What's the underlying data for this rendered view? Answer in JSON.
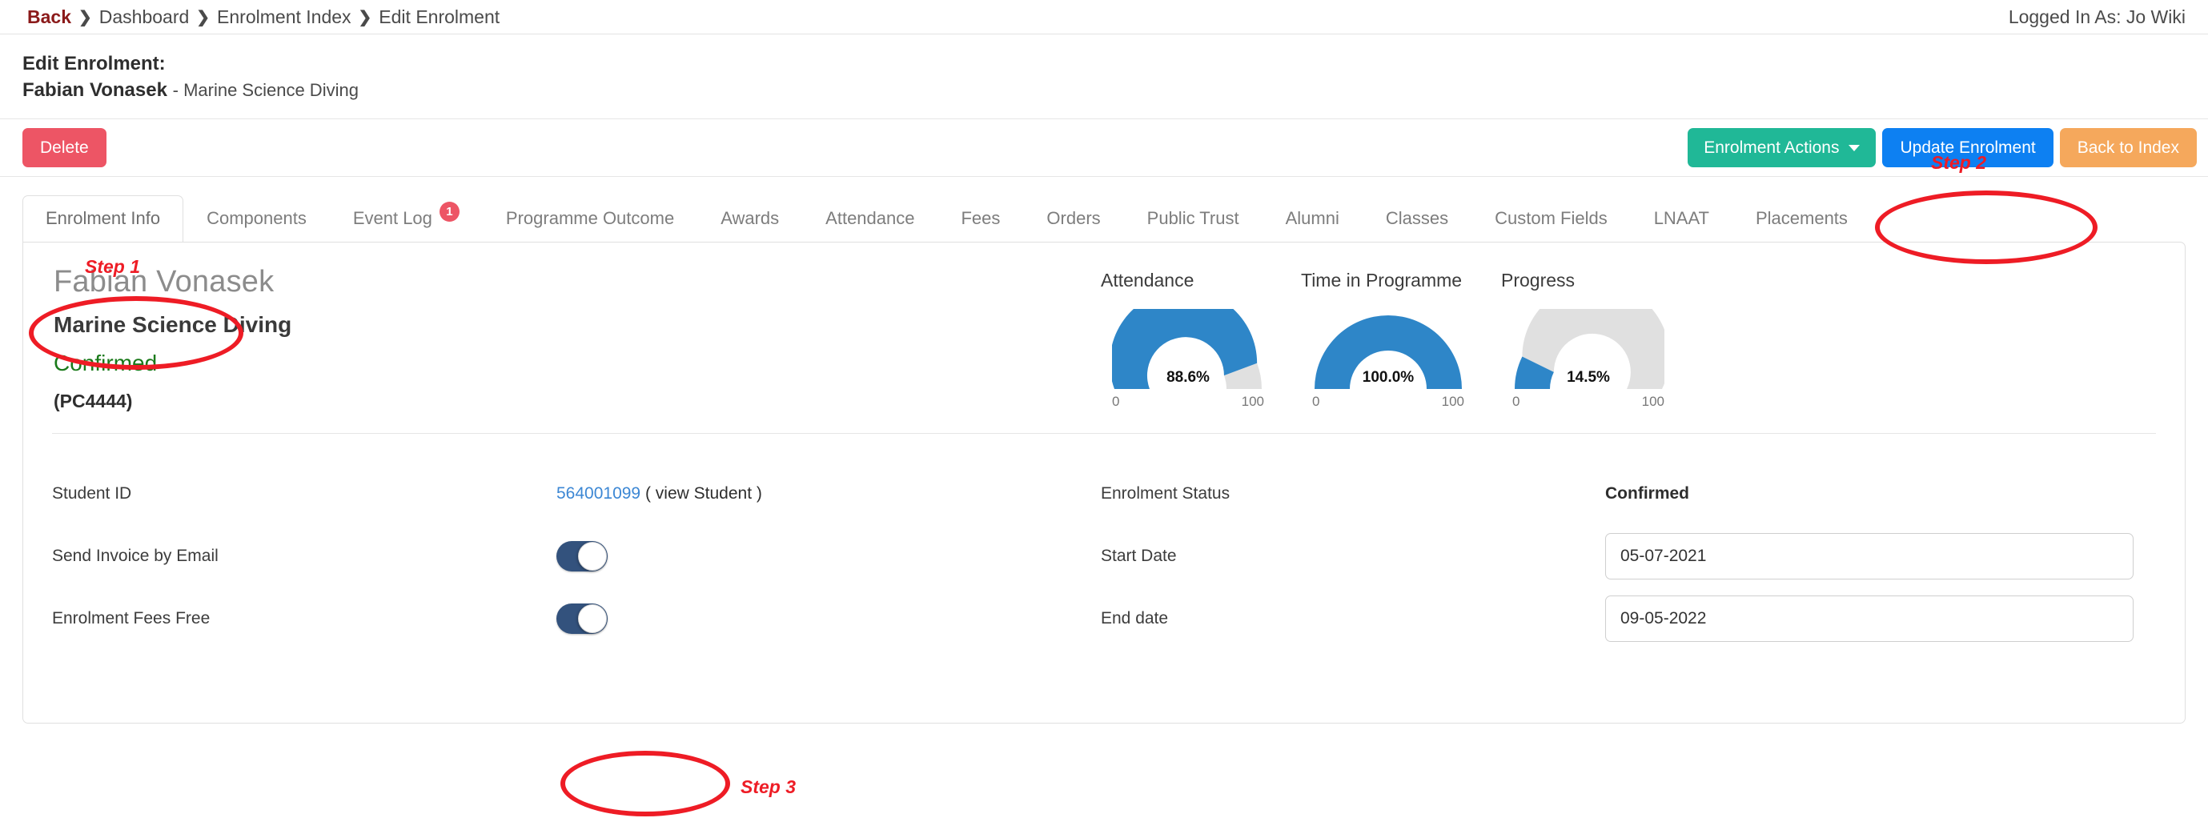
{
  "breadcrumb": {
    "back": "Back",
    "separator": "❯",
    "items": [
      "Dashboard",
      "Enrolment Index",
      "Edit Enrolment"
    ]
  },
  "header": {
    "logged_in_as": "Logged In As: Jo Wiki",
    "title_label": "Edit Enrolment:",
    "student_name": "Fabian Vonasek",
    "programme_suffix": "- Marine Science Diving"
  },
  "actions": {
    "delete_label": "Delete",
    "enrolment_actions_label": "Enrolment Actions",
    "update_label": "Update Enrolment",
    "back_to_index_label": "Back to Index",
    "colors": {
      "delete": "#ed5565",
      "enrolment_actions": "#20b897",
      "update": "#0d80f2",
      "back_to_index": "#f5a85c"
    }
  },
  "tabs": [
    {
      "label": "Enrolment Info",
      "active": true,
      "badge": null
    },
    {
      "label": "Components",
      "active": false,
      "badge": null
    },
    {
      "label": "Event Log",
      "active": false,
      "badge": "1"
    },
    {
      "label": "Programme Outcome",
      "active": false,
      "badge": null
    },
    {
      "label": "Awards",
      "active": false,
      "badge": null
    },
    {
      "label": "Attendance",
      "active": false,
      "badge": null
    },
    {
      "label": "Fees",
      "active": false,
      "badge": null
    },
    {
      "label": "Orders",
      "active": false,
      "badge": null
    },
    {
      "label": "Public Trust",
      "active": false,
      "badge": null
    },
    {
      "label": "Alumni",
      "active": false,
      "badge": null
    },
    {
      "label": "Classes",
      "active": false,
      "badge": null
    },
    {
      "label": "Custom Fields",
      "active": false,
      "badge": null
    },
    {
      "label": "LNAAT",
      "active": false,
      "badge": null
    },
    {
      "label": "Placements",
      "active": false,
      "badge": null
    }
  ],
  "summary": {
    "name": "Fabian Vonasek",
    "programme": "Marine Science Diving",
    "status": "Confirmed",
    "status_color": "#1a7a1a",
    "code": "(PC4444)"
  },
  "chart_data": [
    {
      "type": "pie",
      "title": "Attendance",
      "value": 88.6,
      "value_label": "88.6%",
      "min": 0,
      "max": 100,
      "min_label": "0",
      "max_label": "100",
      "fill_color": "#2e86c8",
      "track_color": "#e0e0e0"
    },
    {
      "type": "pie",
      "title": "Time in Programme",
      "value": 100.0,
      "value_label": "100.0%",
      "min": 0,
      "max": 100,
      "min_label": "0",
      "max_label": "100",
      "fill_color": "#2e86c8",
      "track_color": "#e0e0e0"
    },
    {
      "type": "pie",
      "title": "Progress",
      "value": 14.5,
      "value_label": "14.5%",
      "min": 0,
      "max": 100,
      "min_label": "0",
      "max_label": "100",
      "fill_color": "#2e86c8",
      "track_color": "#e0e0e0"
    }
  ],
  "form": {
    "left": {
      "student_id_label": "Student ID",
      "student_id_value": "564001099",
      "student_id_view": "( view Student )",
      "send_invoice_label": "Send Invoice by Email",
      "send_invoice_on": false,
      "fees_free_label": "Enrolment Fees Free",
      "fees_free_on": false
    },
    "right": {
      "enrolment_status_label": "Enrolment Status",
      "enrolment_status_value": "Confirmed",
      "start_date_label": "Start Date",
      "start_date_value": "05-07-2021",
      "end_date_label": "End date",
      "end_date_value": "09-05-2022"
    }
  },
  "annotations": [
    {
      "label": "Step 1"
    },
    {
      "label": "Step 2"
    },
    {
      "label": "Step 3"
    }
  ]
}
